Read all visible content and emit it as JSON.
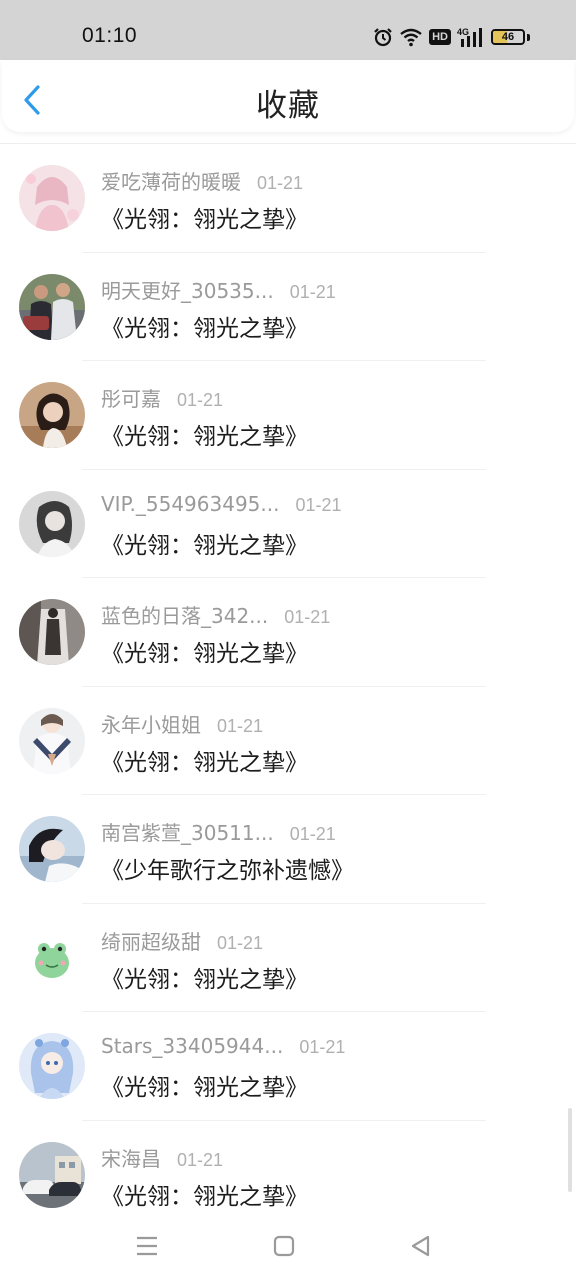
{
  "status": {
    "time": "01:10",
    "hd": "HD",
    "network": "4G",
    "battery": "46",
    "battery_level": 0.46
  },
  "header": {
    "title": "收藏"
  },
  "items": [
    {
      "user": "爱吃薄荷的暖暖",
      "date": "01-21",
      "title": "《光翎：翎光之挚》",
      "avatar": "avatar-pink-anime"
    },
    {
      "user": "明天更好_30535...",
      "date": "01-21",
      "title": "《光翎：翎光之挚》",
      "avatar": "avatar-couple-photo"
    },
    {
      "user": "彤可嘉",
      "date": "01-21",
      "title": "《光翎：翎光之挚》",
      "avatar": "avatar-girl-brown"
    },
    {
      "user": "VIP._554963495...",
      "date": "01-21",
      "title": "《光翎：翎光之挚》",
      "avatar": "avatar-girl-gray"
    },
    {
      "user": "蓝色的日落_342...",
      "date": "01-21",
      "title": "《光翎：翎光之挚》",
      "avatar": "avatar-dark-figure"
    },
    {
      "user": "永年小姐姐",
      "date": "01-21",
      "title": "《光翎：翎光之挚》",
      "avatar": "avatar-sailor-uniform"
    },
    {
      "user": "南宫紫萱_30511...",
      "date": "01-21",
      "title": "《少年歌行之弥补遗憾》",
      "avatar": "avatar-girl-blue"
    },
    {
      "user": "绮丽超级甜",
      "date": "01-21",
      "title": "《光翎：翎光之挚》",
      "avatar": "avatar-green-frog"
    },
    {
      "user": "Stars_33405944...",
      "date": "01-21",
      "title": "《光翎：翎光之挚》",
      "avatar": "avatar-blue-anime"
    },
    {
      "user": "宋海昌",
      "date": "01-21",
      "title": "《光翎：翎光之挚》",
      "avatar": "avatar-cars"
    }
  ],
  "colors": {
    "accent": "#2f9bea",
    "username": "#9a9a9a",
    "date": "#b0b0b0",
    "title": "#1c1c1c",
    "statusbar": "#d4d4d4"
  }
}
